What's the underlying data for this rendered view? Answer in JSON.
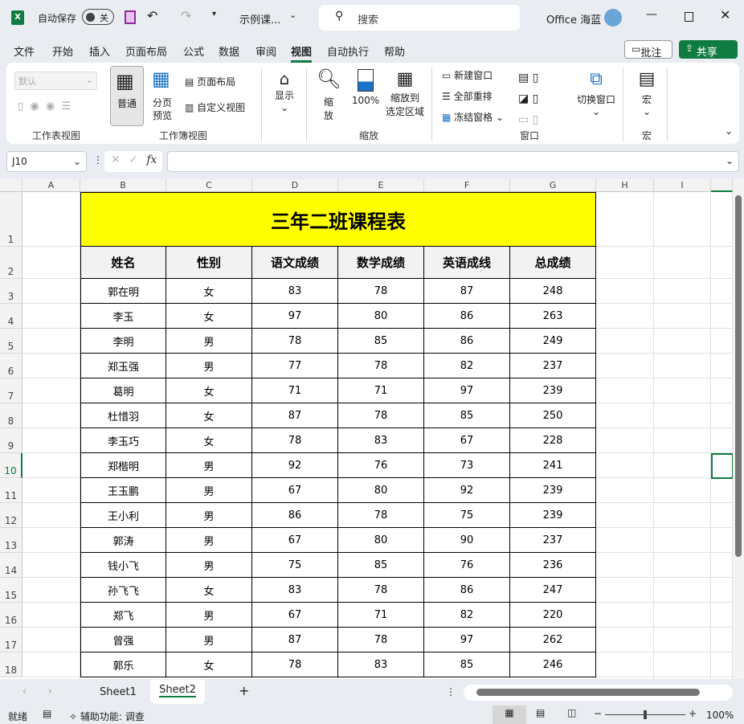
{
  "titlebar": {
    "autosave_label": "自动保存",
    "autosave_state": "关",
    "filename": "示例课...",
    "search_placeholder": "搜索",
    "user": "Office 海蓝"
  },
  "menu": [
    "文件",
    "开始",
    "插入",
    "页面布局",
    "公式",
    "数据",
    "审阅",
    "视图",
    "自动执行",
    "帮助"
  ],
  "menu_active": "视图",
  "comments_btn": "批注",
  "share_btn": "共享",
  "ribbon": {
    "style_dropdown": "默认",
    "normal": "普通",
    "page_break": [
      "分页",
      "预览"
    ],
    "page_layout": "页面布局",
    "custom_views": "自定义视图",
    "show": "显示",
    "zoom": [
      "缩",
      "放"
    ],
    "zoom100": "100%",
    "zoom_selection": [
      "缩放到",
      "选定区域"
    ],
    "new_window": "新建窗口",
    "arrange_all": "全部重排",
    "freeze_panes": "冻结窗格",
    "switch_windows": "切换窗口",
    "macros": "宏",
    "groups": [
      "工作表视图",
      "工作簿视图",
      "缩放",
      "窗口",
      "宏"
    ]
  },
  "formula_bar": {
    "name_box": "J10",
    "fx": "fx",
    "value": ""
  },
  "columns": [
    "A",
    "B",
    "C",
    "D",
    "E",
    "F",
    "G",
    "H",
    "I"
  ],
  "rows": [
    "1",
    "2",
    "3",
    "4",
    "5",
    "6",
    "7",
    "8",
    "9",
    "10",
    "11",
    "12",
    "13",
    "14",
    "15",
    "16",
    "17",
    "18"
  ],
  "sheet": {
    "title": "三年二班课程表",
    "headers": [
      "姓名",
      "性别",
      "语文成绩",
      "数学成绩",
      "英语成线",
      "总成绩"
    ],
    "data": [
      [
        "郭在明",
        "女",
        "83",
        "78",
        "87",
        "248"
      ],
      [
        "李玉",
        "女",
        "97",
        "80",
        "86",
        "263"
      ],
      [
        "李明",
        "男",
        "78",
        "85",
        "86",
        "249"
      ],
      [
        "郑玉强",
        "男",
        "77",
        "78",
        "82",
        "237"
      ],
      [
        "葛明",
        "女",
        "71",
        "71",
        "97",
        "239"
      ],
      [
        "杜惜羽",
        "女",
        "87",
        "78",
        "85",
        "250"
      ],
      [
        "李玉巧",
        "女",
        "78",
        "83",
        "67",
        "228"
      ],
      [
        "郑楷明",
        "男",
        "92",
        "76",
        "73",
        "241"
      ],
      [
        "王玉鹏",
        "男",
        "67",
        "80",
        "92",
        "239"
      ],
      [
        "王小利",
        "男",
        "86",
        "78",
        "75",
        "239"
      ],
      [
        "郭涛",
        "男",
        "67",
        "80",
        "90",
        "237"
      ],
      [
        "钱小飞",
        "男",
        "75",
        "85",
        "76",
        "236"
      ],
      [
        "孙飞飞",
        "女",
        "83",
        "78",
        "86",
        "247"
      ],
      [
        "郑飞",
        "男",
        "67",
        "71",
        "82",
        "220"
      ],
      [
        "曾强",
        "男",
        "87",
        "78",
        "97",
        "262"
      ],
      [
        "郭乐",
        "女",
        "78",
        "83",
        "85",
        "246"
      ]
    ]
  },
  "sheet_tabs": [
    "Sheet1",
    "Sheet2"
  ],
  "active_sheet": "Sheet2",
  "status": {
    "ready": "就绪",
    "accessibility": "辅助功能: 调查",
    "zoom": "100%",
    "zoom_level": 100
  },
  "colors": {
    "accent": "#107c41",
    "title_fill": "#ffff00"
  }
}
